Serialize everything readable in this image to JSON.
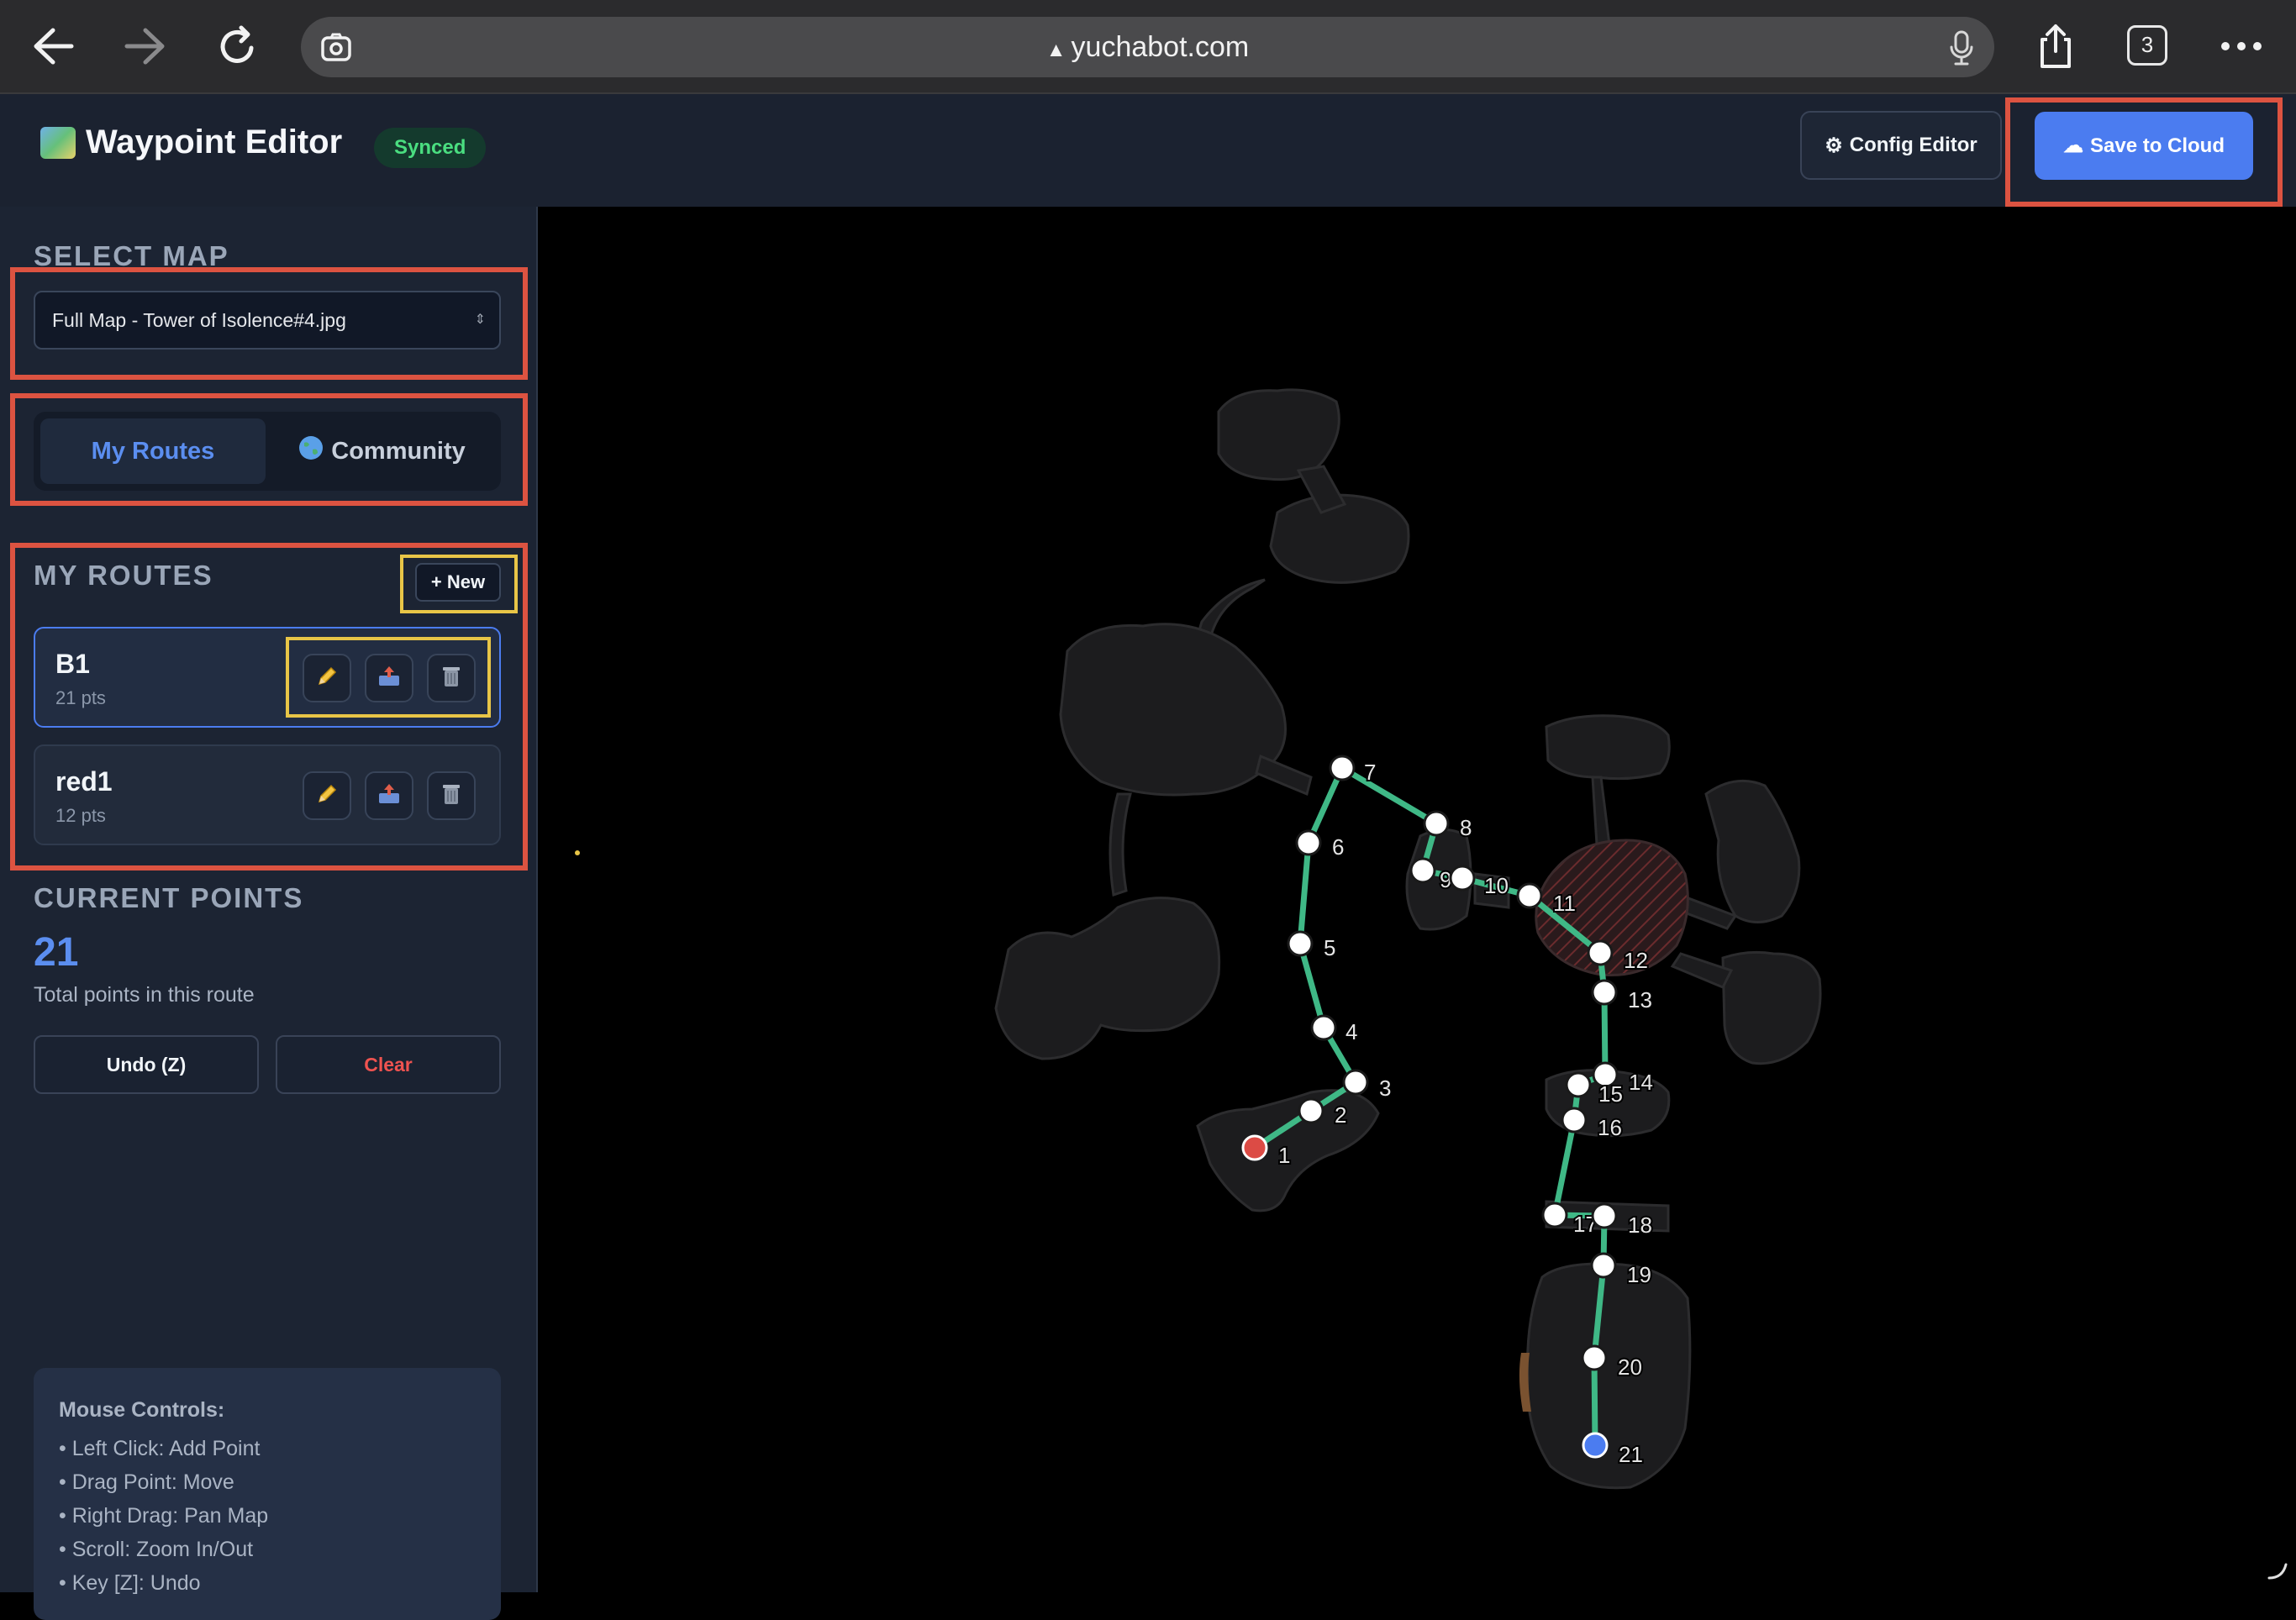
{
  "browser": {
    "url": "yuchabot.com",
    "tab_count": "3",
    "icons": [
      "back-icon",
      "forward-icon",
      "reload-icon",
      "lens-icon",
      "mic-icon",
      "share-icon",
      "tabs-icon",
      "more-icon"
    ]
  },
  "header": {
    "title": "Waypoint Editor",
    "status_badge": "Synced",
    "config_button": "Config Editor",
    "save_button": "Save to Cloud",
    "accent": "#4b7cf0",
    "badge_color": "#4ade80"
  },
  "sidebar": {
    "select_map_title": "SELECT MAP",
    "selected_map": "Full Map - Tower of Isolence#4.jpg",
    "tabs": [
      {
        "label": "My Routes",
        "active": true
      },
      {
        "label": "Community",
        "active": false
      }
    ],
    "my_routes_title": "MY ROUTES",
    "new_button": "+ New",
    "routes": [
      {
        "name": "B1",
        "points": "21 pts",
        "selected": true
      },
      {
        "name": "red1",
        "points": "12 pts",
        "selected": false
      }
    ],
    "current_points_title": "CURRENT POINTS",
    "current_points_count": "21",
    "current_points_desc": "Total points in this route",
    "undo_button": "Undo (Z)",
    "clear_button": "Clear",
    "mouse_controls_title": "Mouse Controls:",
    "mouse_controls": [
      "• Left Click: Add Point",
      "• Drag Point: Move",
      "• Right Drag: Pan Map",
      "• Scroll: Zoom In/Out",
      "• Key [Z]: Undo"
    ]
  },
  "map": {
    "route_color": "#3fb886",
    "start_color": "#dc4b45",
    "end_color": "#4b7cf0",
    "waypoints": [
      "1",
      "2",
      "3",
      "4",
      "5",
      "6",
      "7",
      "8",
      "9",
      "10",
      "11",
      "12",
      "13",
      "14",
      "15",
      "16",
      "17",
      "18",
      "19",
      "20",
      "21"
    ]
  }
}
